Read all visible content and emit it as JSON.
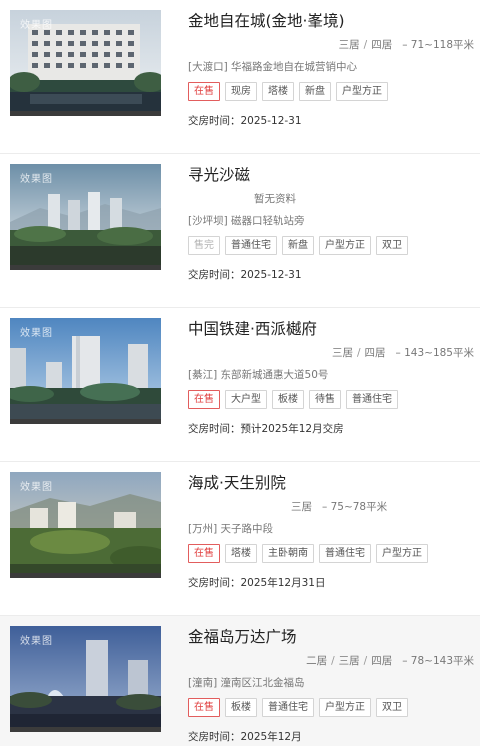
{
  "watermark": "效果图",
  "listings": [
    {
      "title": "金地自在城(金地·峯境)",
      "rooms": [
        "三居",
        "四居"
      ],
      "area": "71~118平米",
      "addr_district": "[大渡口]",
      "addr_detail": "华福路金地自在城营销中心",
      "tags": [
        "在售",
        "现房",
        "塔楼",
        "新盘",
        "户型方正"
      ],
      "delivery": "交房时间：2025-12-31"
    },
    {
      "title": "寻光沙磁",
      "status_note": "暂无资料",
      "addr_district": "[沙坪坝]",
      "addr_detail": "磁器口轻轨站旁",
      "tags": [
        "售完",
        "普通住宅",
        "新盘",
        "户型方正",
        "双卫"
      ],
      "delivery": "交房时间：2025-12-31"
    },
    {
      "title": "中国铁建·西派樾府",
      "rooms": [
        "三居",
        "四居"
      ],
      "area": "143~185平米",
      "addr_district": "[綦江]",
      "addr_detail": "东部新城通惠大道50号",
      "tags": [
        "在售",
        "大户型",
        "板楼",
        "待售",
        "普通住宅"
      ],
      "delivery": "交房时间：预计2025年12月交房"
    },
    {
      "title": "海成·天生别院",
      "rooms": [
        "三居"
      ],
      "area": "75~78平米",
      "addr_district": "[万州]",
      "addr_detail": "天子路中段",
      "tags": [
        "在售",
        "塔楼",
        "主卧朝南",
        "普通住宅",
        "户型方正"
      ],
      "delivery": "交房时间：2025年12月31日"
    },
    {
      "title": "金福岛万达广场",
      "rooms": [
        "二居",
        "三居",
        "四居"
      ],
      "area": "78~143平米",
      "addr_district": "[潼南]",
      "addr_detail": "潼南区江北金福岛",
      "tags": [
        "在售",
        "板楼",
        "普通住宅",
        "户型方正",
        "双卫"
      ],
      "delivery": "交房时间：2025年12月"
    }
  ]
}
